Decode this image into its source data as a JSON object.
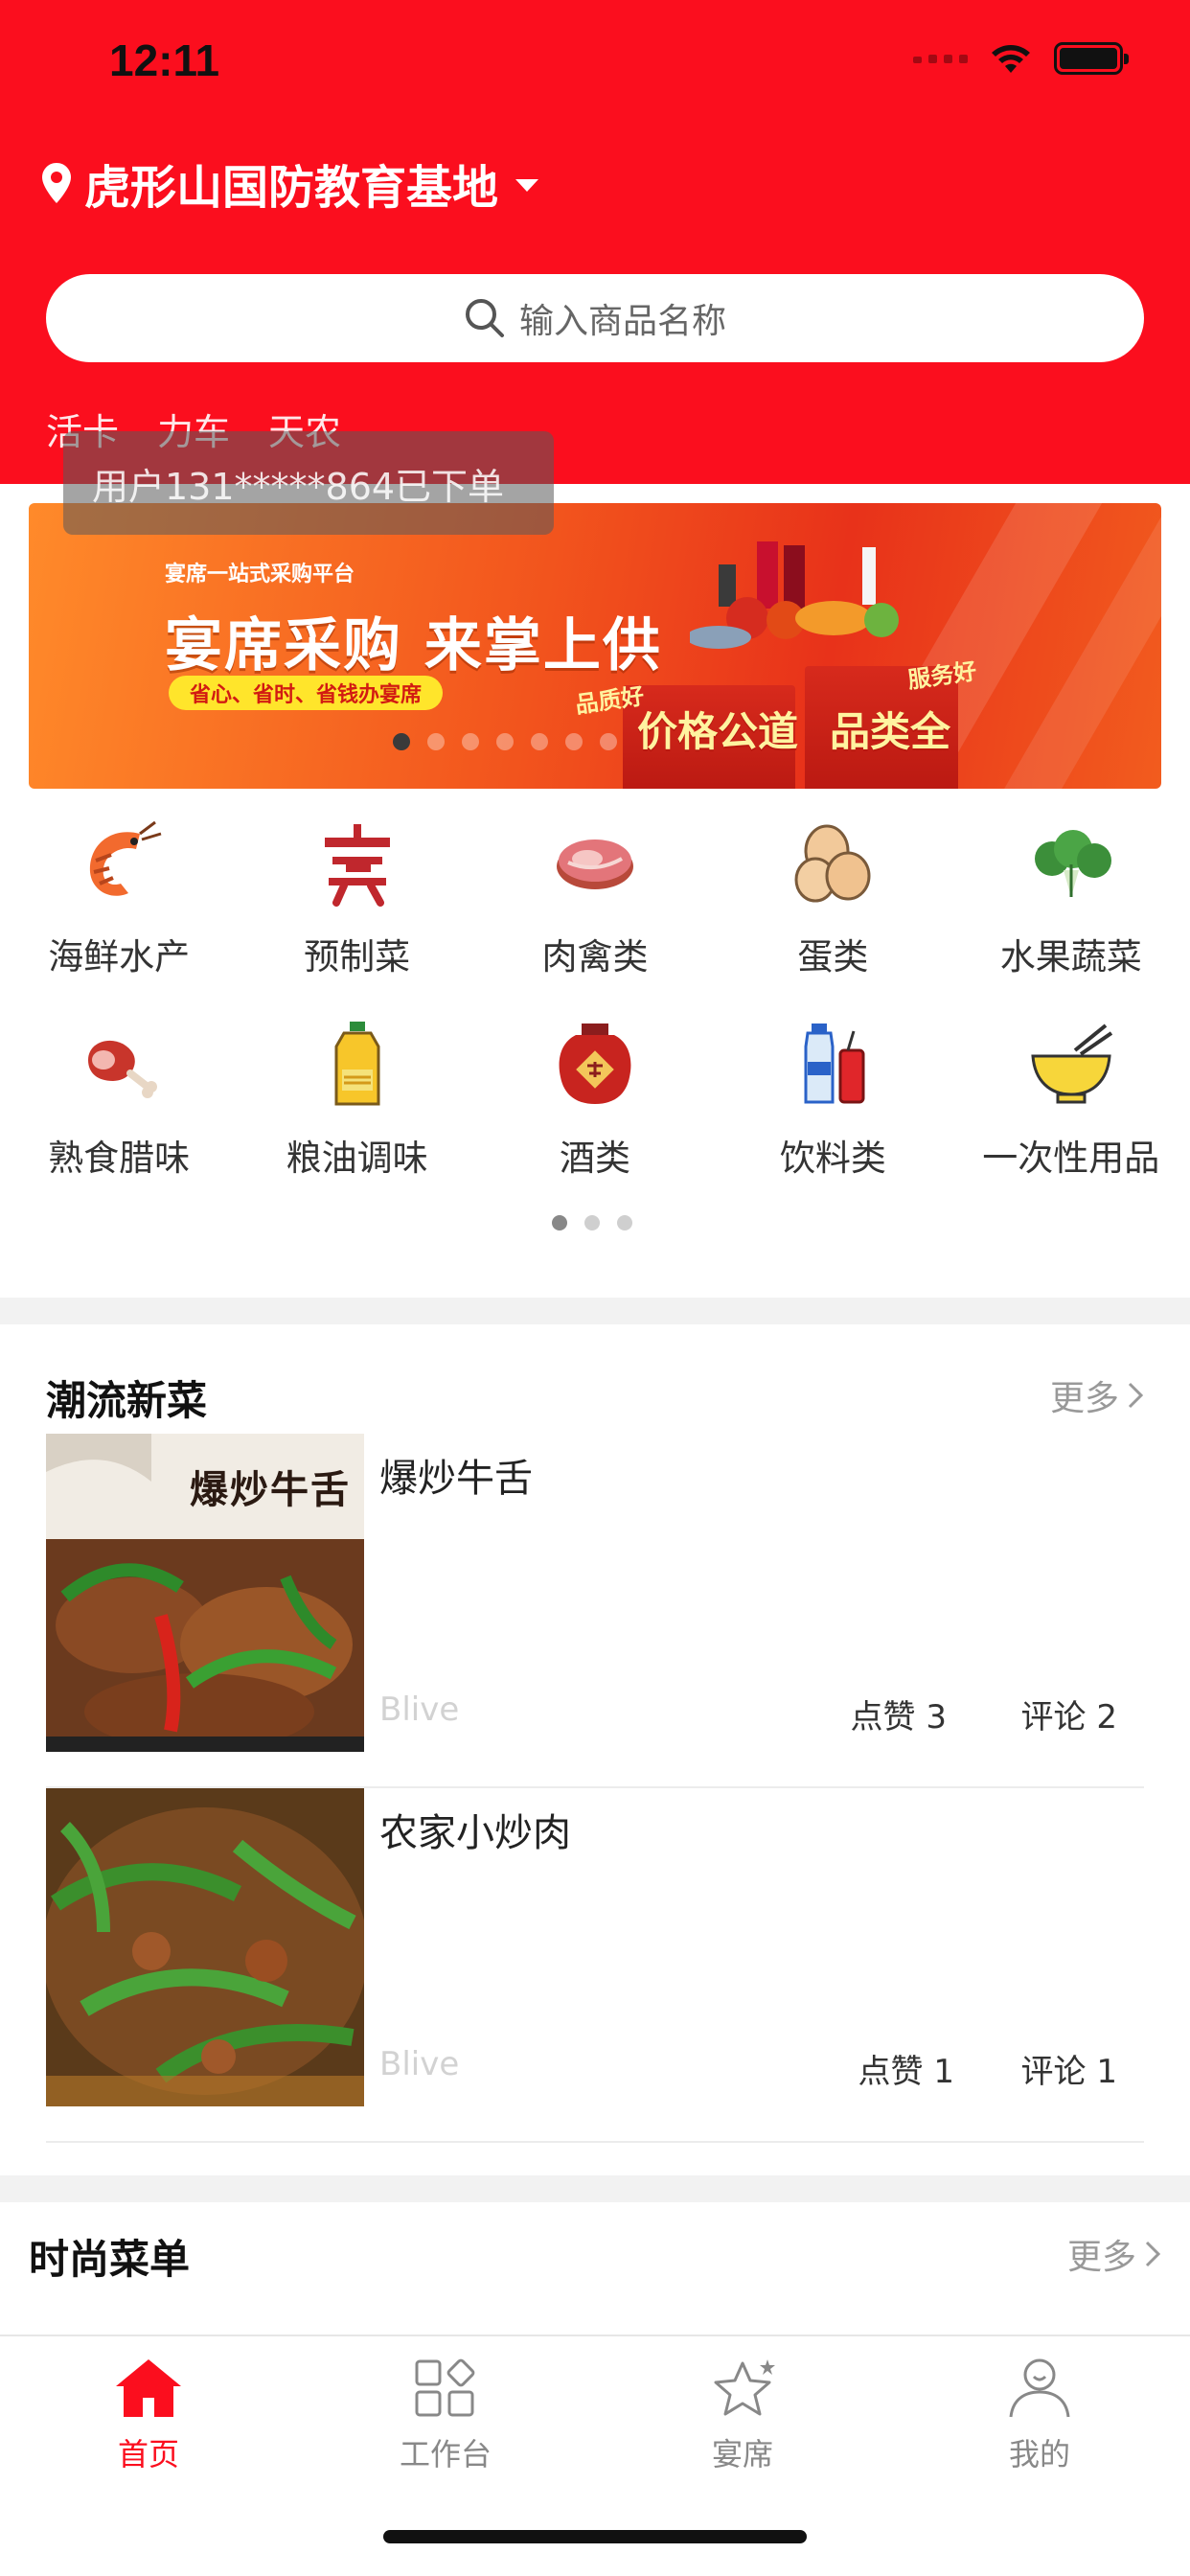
{
  "status_bar": {
    "time": "12:11"
  },
  "header": {
    "location": "虎形山国防教育基地",
    "search_placeholder": "输入商品名称",
    "tags": [
      "活卡",
      "力车",
      "天农"
    ],
    "toast": "用户131*****864已下单"
  },
  "banner": {
    "platform": "宴席一站式采购平台",
    "headline": "宴席采购 来掌上供",
    "subline": "省心、省时、省钱办宴席",
    "badge_quality": "品质好",
    "badge_service": "服务好",
    "tag_price": "价格公道",
    "tag_category": "品类全",
    "dots_total": 7,
    "dots_active": 0
  },
  "categories": [
    [
      {
        "label": "海鲜水产",
        "icon": "shrimp-icon"
      },
      {
        "label": "预制菜",
        "icon": "banquet-character-icon"
      },
      {
        "label": "肉禽类",
        "icon": "meat-icon"
      },
      {
        "label": "蛋类",
        "icon": "egg-icon"
      },
      {
        "label": "水果蔬菜",
        "icon": "vegetable-icon"
      }
    ],
    [
      {
        "label": "熟食腊味",
        "icon": "ham-icon"
      },
      {
        "label": "粮油调味",
        "icon": "oil-bottle-icon"
      },
      {
        "label": "酒类",
        "icon": "wine-jar-icon"
      },
      {
        "label": "饮料类",
        "icon": "drinks-icon"
      },
      {
        "label": "一次性用品",
        "icon": "disposable-bowl-icon"
      }
    ]
  ],
  "trending": {
    "title": "潮流新菜",
    "more": "更多",
    "items": [
      {
        "name": "爆炒牛舌",
        "photo_caption": "爆炒牛舌",
        "author": "Blive",
        "likes": "点赞 3",
        "comments": "评论 2"
      },
      {
        "name": "农家小炒肉",
        "author": "Blive",
        "likes": "点赞 1",
        "comments": "评论 1"
      }
    ]
  },
  "fashion_menu": {
    "title": "时尚菜单",
    "more": "更多"
  },
  "tabbar": [
    {
      "label": "首页",
      "icon": "home-icon",
      "active": true
    },
    {
      "label": "工作台",
      "icon": "workbench-icon",
      "active": false
    },
    {
      "label": "宴席",
      "icon": "star-icon",
      "active": false
    },
    {
      "label": "我的",
      "icon": "profile-icon",
      "active": false
    }
  ],
  "colors": {
    "brand_red": "#fb0e1e",
    "text_muted": "#999999"
  }
}
